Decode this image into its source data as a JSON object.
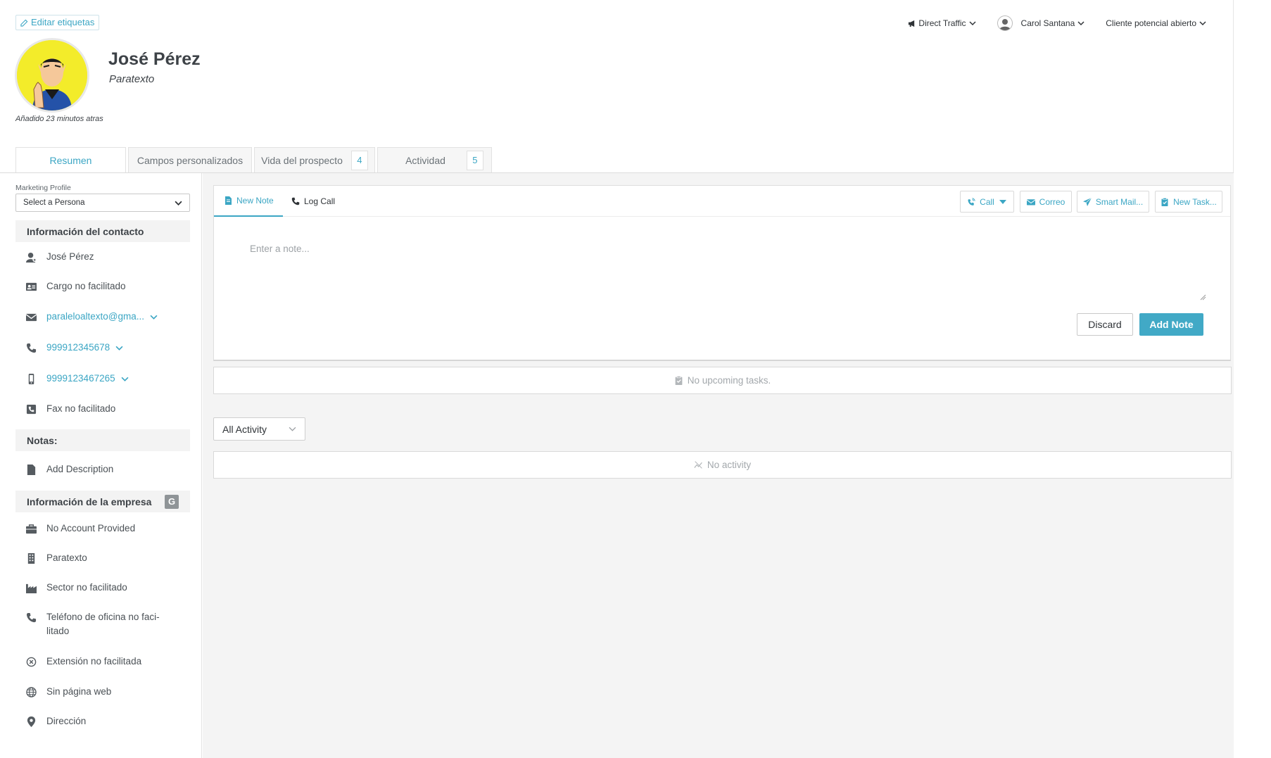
{
  "header": {
    "edit_tags_label": "Editar etiquetas",
    "traffic_source": "Direct Traffic",
    "owner_name": "Carol Santana",
    "status": "Cliente potencial abierto",
    "contact_name": "José Pérez",
    "contact_subtitle": "Paratexto",
    "added_text": "Añadido 23 minutos atras"
  },
  "tabs": [
    {
      "label": "Resumen"
    },
    {
      "label": "Campos personalizados"
    },
    {
      "label": "Vida del prospecto",
      "badge": "4"
    },
    {
      "label": "Actividad",
      "badge": "5"
    }
  ],
  "sidebar": {
    "marketing_profile_label": "Marketing Profile",
    "persona_select": "Select a Persona",
    "contact_section": "Información del contacto",
    "contact_rows": [
      {
        "icon": "user-icon",
        "text": "José Pérez"
      },
      {
        "icon": "id-card-icon",
        "text": "Cargo no facilitado"
      },
      {
        "icon": "envelope-icon",
        "text": "paraleloaltexto@gma..."
      },
      {
        "icon": "phone-icon",
        "text": "999912345678"
      },
      {
        "icon": "mobile-icon",
        "text": "9999123467265"
      },
      {
        "icon": "fax-icon",
        "text": "Fax no facilitado"
      }
    ],
    "notes_section": "Notas:",
    "notes_row": "Add Description",
    "company_section": "Información de la empresa",
    "company_g": "G",
    "company_rows": [
      {
        "icon": "briefcase-icon",
        "text": "No Account Provided"
      },
      {
        "icon": "building-icon",
        "text": "Paratexto"
      },
      {
        "icon": "industry-icon",
        "text": "Sector no facilitado"
      },
      {
        "icon": "phone-icon",
        "text": "Teléfono de oficina no faci- litado"
      },
      {
        "icon": "circle-x-icon",
        "text": "Extensión no facilitada"
      },
      {
        "icon": "globe-icon",
        "text": "Sin página web"
      },
      {
        "icon": "map-pin-icon",
        "text": "Dirección"
      }
    ]
  },
  "composer": {
    "tab_new_note": "New Note",
    "tab_log_call": "Log Call",
    "btn_call": "Call",
    "btn_correo": "Correo",
    "btn_smart_mail": "Smart Mail...",
    "btn_new_task": "New Task...",
    "note_placeholder": "Enter a note...",
    "discard": "Discard",
    "add_note": "Add Note"
  },
  "tasks": {
    "empty_text": "No upcoming tasks."
  },
  "activity": {
    "filter_value": "All Activity",
    "empty_text": "No activity"
  },
  "colors": {
    "accent": "#3ba6c4",
    "primary_button": "#41a9c6",
    "panel_bg": "#f4f4f4",
    "avatar_bg": "#f3ec2a"
  }
}
